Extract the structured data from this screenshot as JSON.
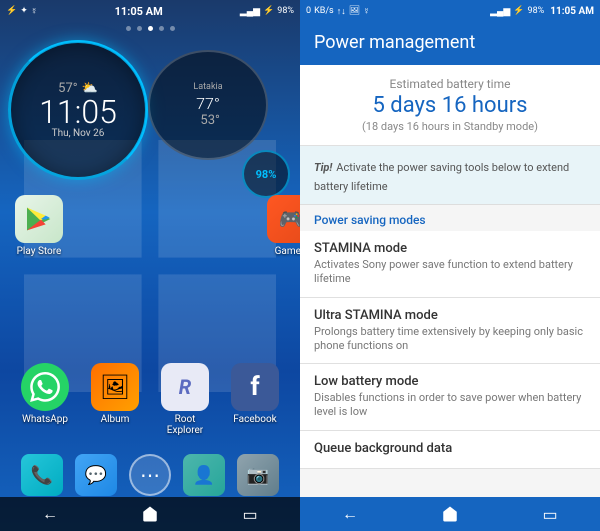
{
  "left": {
    "status": {
      "left_icons": "⚡ ✦ ☿",
      "signal": "▂▄▆█",
      "battery_icon": "🔋",
      "battery_pct": "98%",
      "time": "11:05 AM"
    },
    "page_dots": [
      false,
      false,
      true,
      false,
      false
    ],
    "clock": {
      "temp": "57°",
      "weather_icon": "⛅",
      "time": "11:05",
      "date": "Thu, Nov 26"
    },
    "weather": {
      "city": "Latakia",
      "high": "77°",
      "low": "53°"
    },
    "battery": {
      "pct": "98%"
    },
    "top_apps": [
      {
        "name": "Play Store",
        "label": "Play Store",
        "icon": "▶",
        "color": "#e8f5e9"
      },
      {
        "name": "Games",
        "label": "Game's",
        "icon": "🎮",
        "color": "#ff5722"
      }
    ],
    "apps": [
      {
        "name": "WhatsApp",
        "label": "WhatsApp",
        "icon": "📱",
        "bg": "#25d366"
      },
      {
        "name": "Album",
        "label": "Album",
        "icon": "🖼",
        "bg": "#ff8f00"
      },
      {
        "name": "Root Explorer",
        "label": "Root Explorer",
        "icon": "R",
        "bg": "#e8eaf6"
      },
      {
        "name": "Facebook",
        "label": "Facebook",
        "icon": "f",
        "bg": "#3b5998"
      }
    ],
    "dock": [
      {
        "name": "Phone",
        "icon": "📞",
        "bg": "#26c6da"
      },
      {
        "name": "Messages",
        "icon": "💬",
        "bg": "#42a5f5"
      },
      {
        "name": "App Drawer",
        "icon": "⊞",
        "bg": "transparent"
      },
      {
        "name": "Contacts",
        "icon": "👤",
        "bg": "#4db6ac"
      },
      {
        "name": "Camera",
        "icon": "📷",
        "bg": "#607d8b"
      }
    ],
    "nav": [
      {
        "name": "Back",
        "icon": "←"
      },
      {
        "name": "Home",
        "icon": "⊞"
      },
      {
        "name": "Recents",
        "icon": "□"
      }
    ]
  },
  "right": {
    "status": {
      "left_icons": "0 KB/s ↑↓ 🖼 ☿",
      "signal": "▂▄▆█",
      "battery_icon": "🔋",
      "battery_pct": "98%",
      "time": "11:05 AM"
    },
    "title": "Power management",
    "battery_estimate": {
      "label": "Estimated battery time",
      "time": "5 days 16 hours",
      "standby": "(18 days 16 hours in Standby mode)"
    },
    "tip": {
      "label": "Tip!",
      "text": "Activate the power saving tools below to extend battery lifetime"
    },
    "section_header": "Power saving modes",
    "modes": [
      {
        "title": "STAMINA mode",
        "desc": "Activates Sony power save function to extend battery lifetime"
      },
      {
        "title": "Ultra STAMINA mode",
        "desc": "Prolongs battery time extensively by keeping only basic phone functions on"
      },
      {
        "title": "Low battery mode",
        "desc": "Disables functions in order to save power when battery level is low"
      },
      {
        "title": "Queue background data",
        "desc": ""
      }
    ],
    "nav": [
      {
        "name": "Back",
        "icon": "←"
      },
      {
        "name": "Home",
        "icon": "⊞"
      },
      {
        "name": "Recents",
        "icon": "□"
      }
    ]
  }
}
